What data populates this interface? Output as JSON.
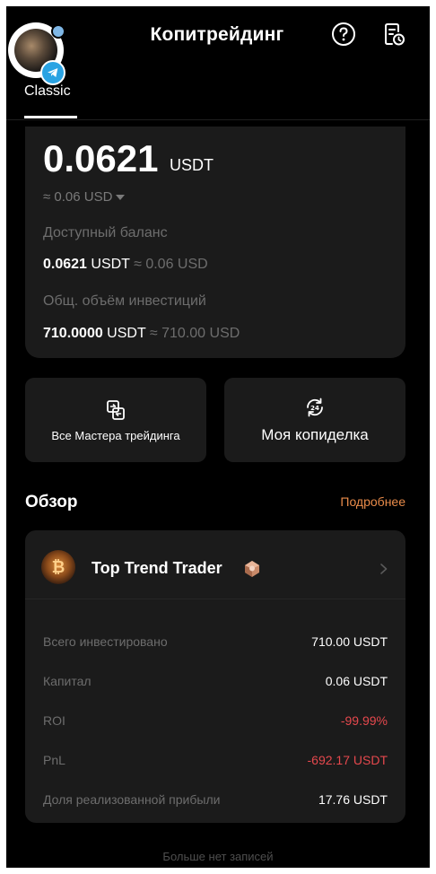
{
  "header": {
    "title": "Копитрейдинг",
    "tab": "Classic"
  },
  "balance": {
    "amount": "0.0621",
    "unit": "USDT",
    "approx": "≈ 0.06 USD",
    "available_label": "Доступный баланс",
    "available_amount": "0.0621",
    "available_unit": " USDT",
    "available_approx": " ≈ 0.06 USD",
    "invest_label": "Общ. объём инвестиций",
    "invest_amount": "710.0000",
    "invest_unit": " USDT",
    "invest_approx": " ≈ 710.00 USD"
  },
  "actions": {
    "masters_label": "Все Мастера трейдинга",
    "mycopy_label": "Моя копиделка"
  },
  "overview": {
    "title": "Обзор",
    "more_link": "Подробнее",
    "trader": {
      "name": "Top Trend Trader",
      "avatar_glyph": "₿",
      "stats": [
        {
          "label": "Всего инвестировано",
          "value": "710.00 USDT",
          "negative": false
        },
        {
          "label": "Капитал",
          "value": "0.06 USDT",
          "negative": false
        },
        {
          "label": "ROI",
          "value": "-99.99%",
          "negative": true
        },
        {
          "label": "PnL",
          "value": "-692.17 USDT",
          "negative": true
        },
        {
          "label": "Доля реализованной прибыли",
          "value": "17.76 USDT",
          "negative": false
        }
      ]
    }
  },
  "footer": {
    "note": "Больше нет записей"
  },
  "colors": {
    "background": "#000000",
    "card": "#1b1b1b",
    "accent": "#e98b4a",
    "negative": "#e5484d",
    "muted": "#6d6d6d"
  },
  "icons": {
    "avatar": "profile-avatar",
    "telegram": "telegram-icon",
    "help": "help-circle-icon",
    "history": "order-history-icon",
    "swap": "swap-icon",
    "copy_cycle": "copy-cycle-icon",
    "badge": "gem-badge-icon",
    "chevron": "chevron-right-icon"
  }
}
